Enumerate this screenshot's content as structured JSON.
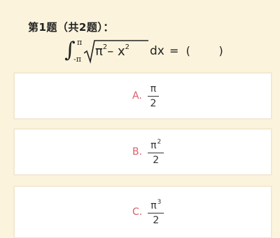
{
  "question": {
    "header": "第1题（共2题）：",
    "integral_upper": "π",
    "integral_lower": "-π",
    "radicand_a": "π",
    "radicand_a_exp": "2",
    "radicand_minus": "–",
    "radicand_b": "x",
    "radicand_b_exp": "2",
    "differential": "dx",
    "equals_blank": "=  (        )"
  },
  "options": [
    {
      "letter": "A.",
      "numerator": "π",
      "exponent": "",
      "denominator": "2"
    },
    {
      "letter": "B.",
      "numerator": "π",
      "exponent": "2",
      "denominator": "2"
    },
    {
      "letter": "C.",
      "numerator": "π",
      "exponent": "3",
      "denominator": "2"
    }
  ],
  "colors": {
    "background": "#fbf3dc",
    "option_letter": "#d8606a",
    "text": "#222222"
  }
}
